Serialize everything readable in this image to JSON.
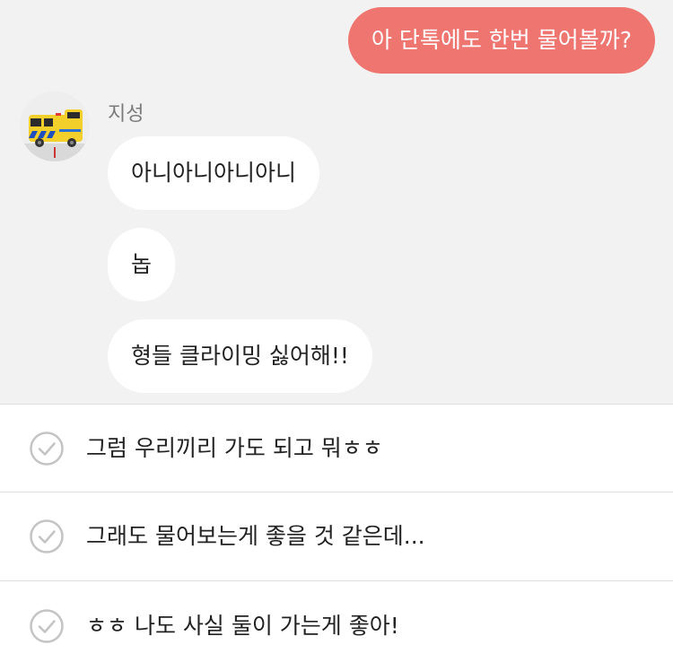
{
  "chat": {
    "sent_message": "아 단톡에도 한번 물어볼까?",
    "sender_name": "지성",
    "received_messages": [
      "아니아니아니아니",
      "놉",
      "형들 클라이밍 싫어해!!"
    ]
  },
  "reply_options": [
    "그럼 우리끼리 가도 되고 뭐ㅎㅎ",
    "그래도 물어보는게 좋을 것 같은데...",
    "ㅎㅎ 나도 사실 둘이 가는게 좋아!"
  ],
  "colors": {
    "sent_bubble": "#ef7670",
    "chat_background": "#f2f2f2",
    "check_icon": "#c4c4c4"
  }
}
